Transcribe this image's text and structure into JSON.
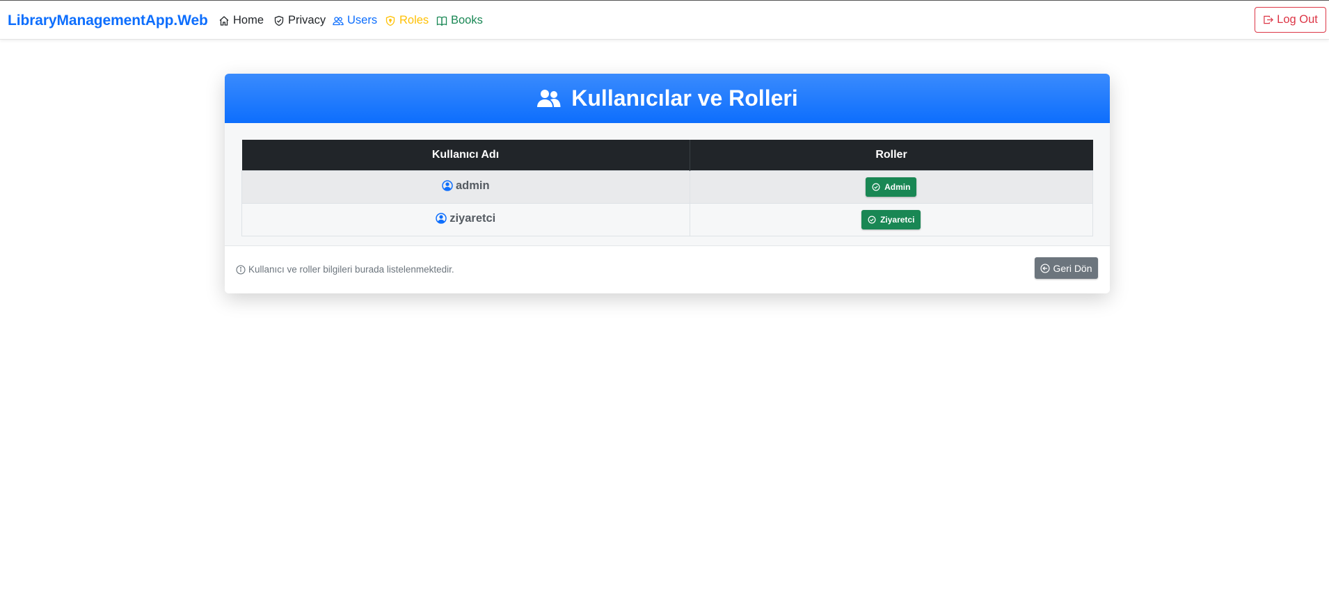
{
  "navbar": {
    "brand": "LibraryManagementApp.Web",
    "items": [
      {
        "label": "Home",
        "icon": "house-icon",
        "color": "#212529"
      },
      {
        "label": "Privacy",
        "icon": "shield-check-icon",
        "color": "#212529"
      },
      {
        "label": "Users",
        "icon": "people-icon",
        "color": "#0d6efd"
      },
      {
        "label": "Roles",
        "icon": "shield-lock-icon",
        "color": "#ffc107"
      },
      {
        "label": "Books",
        "icon": "book-icon",
        "color": "#198754"
      }
    ],
    "logout_label": "Log Out"
  },
  "card": {
    "title": "Kullanıcılar ve Rolleri",
    "table": {
      "headers": [
        "Kullanıcı Adı",
        "Roller"
      ],
      "rows": [
        {
          "username": "admin",
          "role": "Admin"
        },
        {
          "username": "ziyaretci",
          "role": "Ziyaretci"
        }
      ]
    },
    "footer_note": "Kullanıcı ve roller bilgileri burada listelenmektedir.",
    "back_label": "Geri Dön"
  },
  "colors": {
    "primary": "#0d6efd",
    "success": "#198754",
    "warning": "#ffc107",
    "danger": "#dc3545",
    "secondary": "#6c757d",
    "dark": "#212529"
  }
}
